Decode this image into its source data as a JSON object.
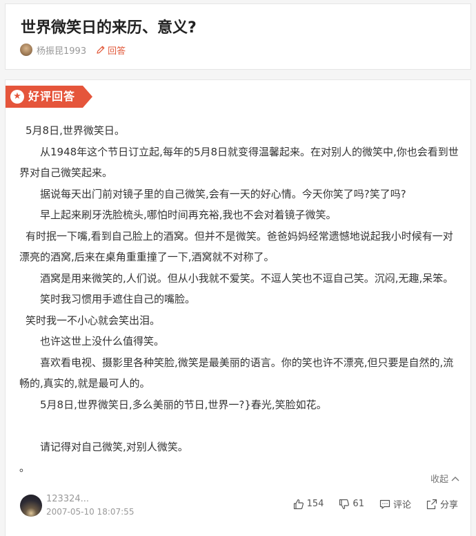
{
  "question": {
    "title": "世界微笑日的来历、意义?",
    "author": "杨振昆1993",
    "answer_link": "回答"
  },
  "answer": {
    "badge": "好评回答",
    "paragraphs": [
      "5月8日,世界微笑日。",
      "从1948年这个节日订立起,每年的5月8日就变得温馨起来。在对别人的微笑中,你也会看到世界对自己微笑起来。",
      "据说每天出门前对镜子里的自己微笑,会有一天的好心情。今天你笑了吗?笑了吗?",
      "早上起来刷牙洗脸梳头,哪怕时间再充裕,我也不会对着镜子微笑。",
      "有时抿一下嘴,看到自己脸上的酒窝。但并不是微笑。爸爸妈妈经常遗憾地说起我小时候有一对漂亮的酒窝,后来在桌角重重撞了一下,酒窝就不对称了。",
      "酒窝是用来微笑的,人们说。但从小我就不爱笑。不逗人笑也不逗自己笑。沉闷,无趣,呆笨。",
      "笑时我习惯用手遮住自己的嘴脸。",
      "笑时我一不小心就会笑出泪。",
      "也许这世上没什么值得笑。",
      "喜欢看电视、摄影里各种笑脸,微笑是最美丽的语言。你的笑也许不漂亮,但只要是自然的,流畅的,真实的,就是最可人的。",
      "5月8日,世界微笑日,多么美丽的节日,世界一?}春光,笑脸如花。",
      "请记得对自己微笑,对别人微笑。",
      "。"
    ],
    "collapse_label": "收起",
    "user": "123324...",
    "time": "2007-05-10 18:07:55",
    "actions": {
      "likes": "154",
      "dislikes": "61",
      "comment": "评论",
      "share": "分享"
    }
  },
  "colors": {
    "accent": "#e5553b",
    "text": "#333333",
    "muted": "#999999"
  }
}
